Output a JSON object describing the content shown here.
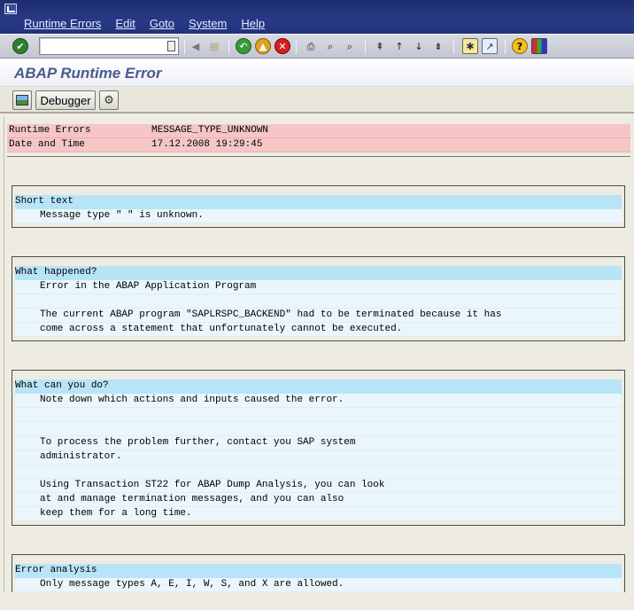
{
  "menu": [
    "Runtime Errors",
    "Edit",
    "Goto",
    "System",
    "Help"
  ],
  "title": "ABAP Runtime Error",
  "app_toolbar": {
    "debugger_label": "Debugger"
  },
  "header": [
    {
      "label": "Runtime Errors",
      "value": "MESSAGE_TYPE_UNKNOWN"
    },
    {
      "label": "Date and Time",
      "value": "17.12.2008 19:29:45"
    }
  ],
  "sections": [
    {
      "title": "Short text",
      "lines": [
        "Message type \" \" is unknown."
      ]
    },
    {
      "title": "What happened?",
      "lines": [
        "Error in the ABAP Application Program",
        "",
        "The current ABAP program \"SAPLRSPC_BACKEND\" had to be terminated because it has",
        "come across a statement that unfortunately cannot be executed."
      ]
    },
    {
      "title": "What can you do?",
      "lines": [
        "Note down which actions and inputs caused the error.",
        "",
        "",
        "To process the problem further, contact you SAP system",
        "administrator.",
        "",
        "Using Transaction ST22 for ABAP Dump Analysis, you can look",
        "at and manage termination messages, and you can also",
        "keep them for a long time."
      ]
    },
    {
      "title": "Error analysis",
      "lines": [
        "Only message types A, E, I, W, S, and X are allowed."
      ]
    }
  ],
  "colors": {
    "menubar": "#22327a",
    "title": "#4b5a8e",
    "header_row": "#f6c6c6",
    "section_head": "#b8e4f8",
    "section_line": "#eaf6fb"
  }
}
